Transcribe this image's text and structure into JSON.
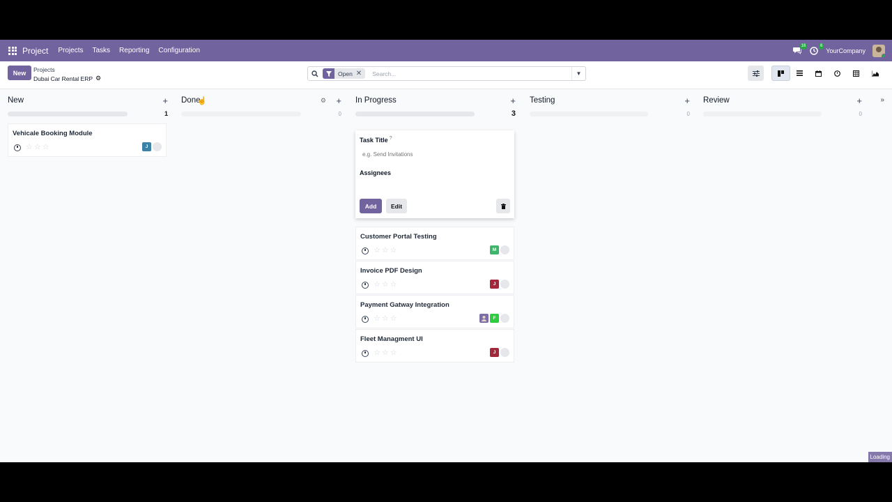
{
  "navbar": {
    "app_name": "Project",
    "menu": [
      "Projects",
      "Tasks",
      "Reporting",
      "Configuration"
    ],
    "messages_count": "16",
    "activities_count": "6",
    "company": "YourCompany"
  },
  "control": {
    "new_label": "New",
    "breadcrumb_parent": "Projects",
    "breadcrumb_current": "Dubai Car Rental ERP",
    "filter_facet": "Open",
    "search_placeholder": "Search...",
    "views": [
      "kanban",
      "list",
      "calendar",
      "activity",
      "pivot",
      "graph"
    ],
    "active_view": "kanban"
  },
  "columns": [
    {
      "title": "New",
      "count": "1",
      "progress_percent": 100
    },
    {
      "title": "Done",
      "count": "0",
      "progress_percent": 0
    },
    {
      "title": "In Progress",
      "count": "3",
      "progress_percent": 100
    },
    {
      "title": "Testing",
      "count": "0",
      "progress_percent": 0
    },
    {
      "title": "Review",
      "count": "0",
      "progress_percent": 0
    }
  ],
  "quick_create": {
    "task_title_label": "Task Title",
    "help_mark": "?",
    "task_title_placeholder": "e.g. Send Invitations",
    "assignees_label": "Assignees",
    "add_label": "Add",
    "edit_label": "Edit"
  },
  "cards": {
    "new": [
      {
        "title": "Vehicale Booking Module",
        "avatars": [
          {
            "letter": "J",
            "color": "#3b82a6"
          }
        ]
      }
    ],
    "in_progress": [
      {
        "title": "Customer Portal Testing",
        "avatars": [
          {
            "letter": "M",
            "color": "#3fb56c"
          }
        ]
      },
      {
        "title": "Invoice PDF Design",
        "avatars": [
          {
            "letter": "J",
            "color": "#a3283a"
          }
        ]
      },
      {
        "title": "Payment Gatway Integration",
        "avatars": [
          {
            "letter": "",
            "color": "#7c6fa8"
          },
          {
            "letter": "F",
            "color": "#2ecc40"
          }
        ]
      },
      {
        "title": "Fleet Managment UI",
        "avatars": [
          {
            "letter": "J",
            "color": "#a3283a"
          }
        ]
      }
    ]
  },
  "status": {
    "loading_label": "Loading"
  },
  "colors": {
    "brand": "#71639e",
    "background": "#f9fafb"
  }
}
